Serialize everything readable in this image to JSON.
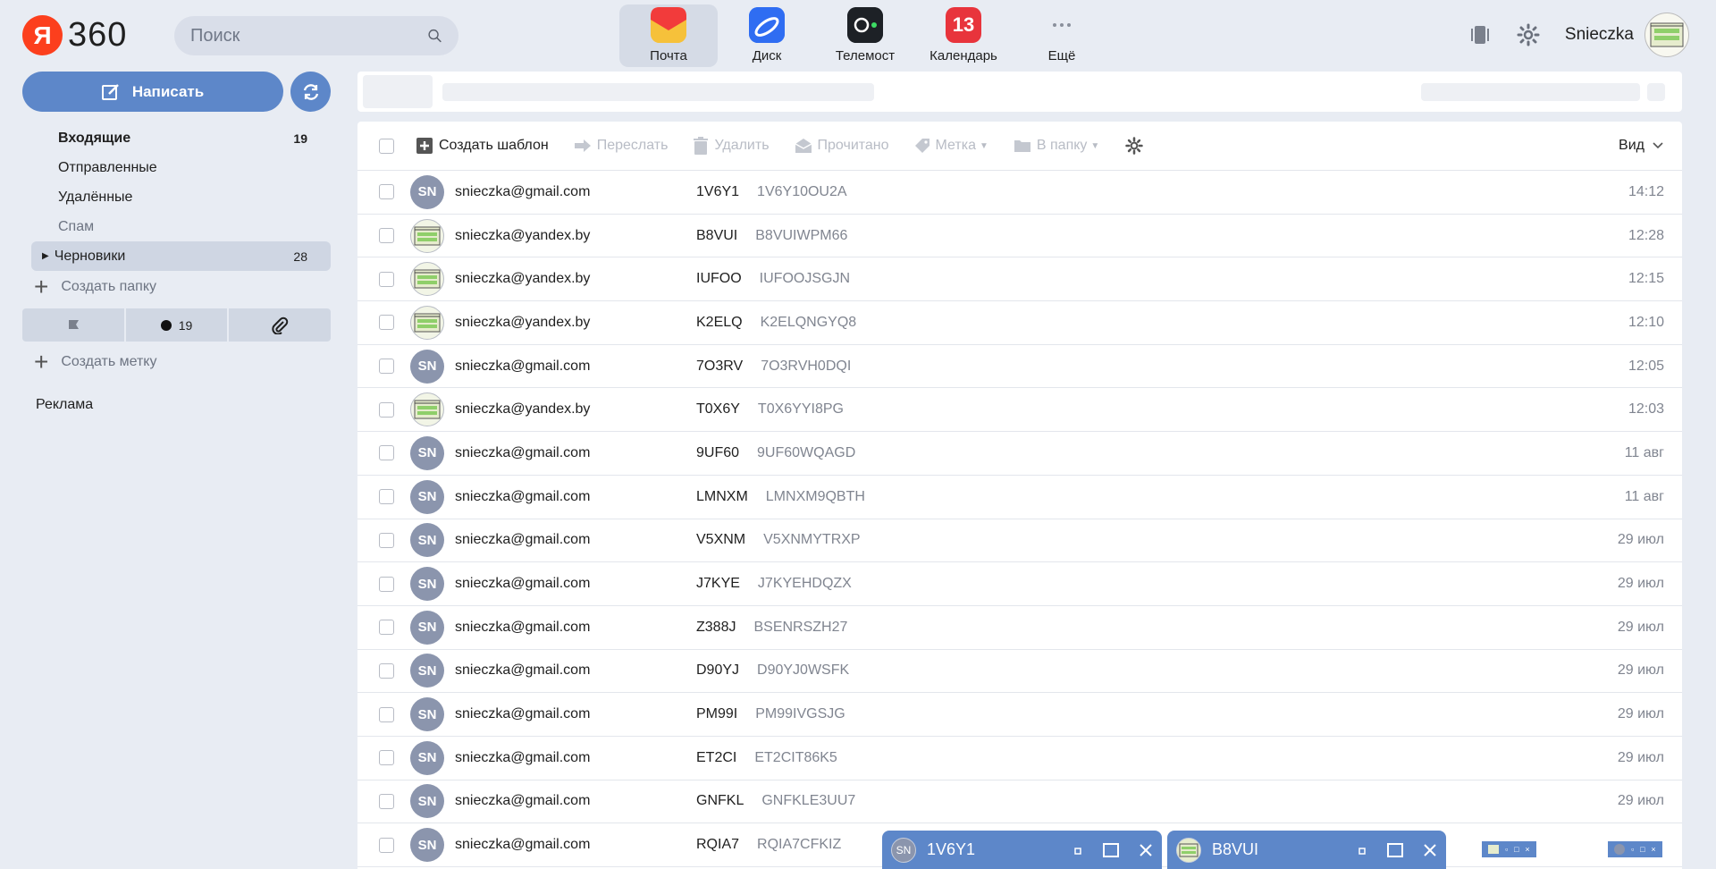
{
  "header": {
    "logo_letter": "Я",
    "logo_text": "360",
    "search_placeholder": "Поиск",
    "apps": [
      {
        "label": "Почта",
        "icon": "mail-icon",
        "color": "#f6c13a",
        "active": true
      },
      {
        "label": "Диск",
        "icon": "disk-icon",
        "color": "#2f6df2"
      },
      {
        "label": "Телемост",
        "icon": "telemost-icon",
        "color": "#1d2126"
      },
      {
        "label": "Календарь",
        "icon": "calendar-icon",
        "color": "#e8343c",
        "badge": "13"
      },
      {
        "label": "Ещё",
        "icon": "more-icon",
        "color": "#8a909c"
      }
    ],
    "username": "Snieczka"
  },
  "sidebar": {
    "compose_label": "Написать",
    "folders": [
      {
        "name": "Входящие",
        "count": "19"
      },
      {
        "name": "Отправленные",
        "count": ""
      },
      {
        "name": "Удалённые",
        "count": ""
      },
      {
        "name": "Спам",
        "count": ""
      },
      {
        "name": "Черновики",
        "count": "28"
      }
    ],
    "create_folder": "Создать папку",
    "filters": {
      "unread_count": "19"
    },
    "create_label": "Создать метку",
    "ad": "Реклама"
  },
  "toolbar": {
    "template": "Создать шаблон",
    "forward": "Переслать",
    "delete": "Удалить",
    "read": "Прочитано",
    "label": "Метка",
    "to_folder": "В папку",
    "view": "Вид"
  },
  "messages": [
    {
      "avatar": "SN",
      "from": "snieczka@gmail.com",
      "subject": "1V6Y1",
      "snippet": "1V6Y10OU2A",
      "date": "14:12"
    },
    {
      "avatar": "img",
      "from": "snieczka@yandex.by",
      "subject": "B8VUI",
      "snippet": "B8VUIWPM66",
      "date": "12:28"
    },
    {
      "avatar": "img",
      "from": "snieczka@yandex.by",
      "subject": "IUFOO",
      "snippet": "IUFOOJSGJN",
      "date": "12:15"
    },
    {
      "avatar": "img",
      "from": "snieczka@yandex.by",
      "subject": "K2ELQ",
      "snippet": "K2ELQNGYQ8",
      "date": "12:10"
    },
    {
      "avatar": "SN",
      "from": "snieczka@gmail.com",
      "subject": "7O3RV",
      "snippet": "7O3RVH0DQI",
      "date": "12:05"
    },
    {
      "avatar": "img",
      "from": "snieczka@yandex.by",
      "subject": "T0X6Y",
      "snippet": "T0X6YYI8PG",
      "date": "12:03"
    },
    {
      "avatar": "SN",
      "from": "snieczka@gmail.com",
      "subject": "9UF60",
      "snippet": "9UF60WQAGD",
      "date": "11 авг"
    },
    {
      "avatar": "SN",
      "from": "snieczka@gmail.com",
      "subject": "LMNXM",
      "snippet": "LMNXM9QBTH",
      "date": "11 авг"
    },
    {
      "avatar": "SN",
      "from": "snieczka@gmail.com",
      "subject": "V5XNM",
      "snippet": "V5XNMYTRXP",
      "date": "29 июл"
    },
    {
      "avatar": "SN",
      "from": "snieczka@gmail.com",
      "subject": "J7KYE",
      "snippet": "J7KYEHDQZX",
      "date": "29 июл"
    },
    {
      "avatar": "SN",
      "from": "snieczka@gmail.com",
      "subject": "Z388J",
      "snippet": "BSENRSZH27",
      "date": "29 июл"
    },
    {
      "avatar": "SN",
      "from": "snieczka@gmail.com",
      "subject": "D90YJ",
      "snippet": "D90YJ0WSFK",
      "date": "29 июл"
    },
    {
      "avatar": "SN",
      "from": "snieczka@gmail.com",
      "subject": "PM99I",
      "snippet": "PM99IVGSJG",
      "date": "29 июл"
    },
    {
      "avatar": "SN",
      "from": "snieczka@gmail.com",
      "subject": "ET2CI",
      "snippet": "ET2CIT86K5",
      "date": "29 июл"
    },
    {
      "avatar": "SN",
      "from": "snieczka@gmail.com",
      "subject": "GNFKL",
      "snippet": "GNFKLE3UU7",
      "date": "29 июл"
    },
    {
      "avatar": "SN",
      "from": "snieczka@gmail.com",
      "subject": "RQIA7",
      "snippet": "RQIA7CFKIZ",
      "date": ""
    }
  ],
  "draft_tabs": [
    {
      "avatar": "SN",
      "title": "1V6Y1"
    },
    {
      "avatar": "img",
      "title": "B8VUI"
    }
  ],
  "colors": {
    "accent": "#5d87c9",
    "background": "#e8ecf3",
    "calendar_red": "#e8343c",
    "logo_red": "#fc3f1d"
  }
}
